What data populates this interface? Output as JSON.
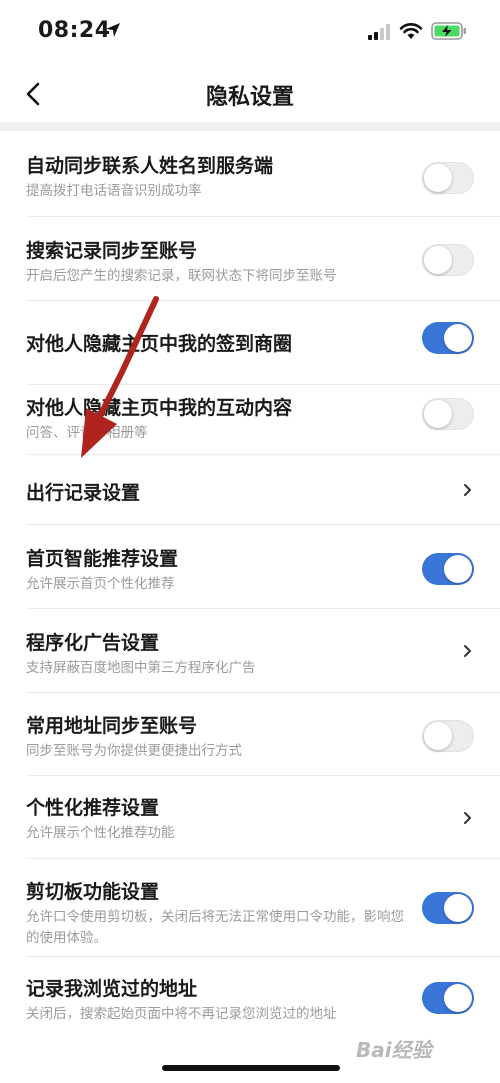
{
  "status_bar": {
    "time": "08:24",
    "icons": [
      "location-arrow-icon",
      "signal-bars-icon",
      "wifi-icon",
      "battery-charging-icon"
    ]
  },
  "nav": {
    "back_icon": "chevron-left-icon",
    "title": "隐私设置"
  },
  "settings": [
    {
      "title": "自动同步联系人姓名到服务端",
      "subtitle": "提高拨打电话语音识别成功率",
      "control": "toggle",
      "on": false
    },
    {
      "title": "搜索记录同步至账号",
      "subtitle": "开启后您产生的搜索记录，联网状态下将同步至账号",
      "control": "toggle",
      "on": false
    },
    {
      "title": "对他人隐藏主页中我的签到商圈",
      "subtitle": "",
      "control": "toggle",
      "on": true
    },
    {
      "title": "对他人隐藏主页中我的互动内容",
      "subtitle": "问答、评论、相册等",
      "control": "toggle",
      "on": false
    },
    {
      "title": "出行记录设置",
      "subtitle": "",
      "control": "chevron"
    },
    {
      "title": "首页智能推荐设置",
      "subtitle": "允许展示首页个性化推荐",
      "control": "toggle",
      "on": true
    },
    {
      "title": "程序化广告设置",
      "subtitle": "支持屏蔽百度地图中第三方程序化广告",
      "control": "chevron"
    },
    {
      "title": "常用地址同步至账号",
      "subtitle": "同步至账号为你提供更便捷出行方式",
      "control": "toggle",
      "on": false
    },
    {
      "title": "个性化推荐设置",
      "subtitle": "允许展示个性化推荐功能",
      "control": "chevron"
    },
    {
      "title": "剪切板功能设置",
      "subtitle": "允许口令使用剪切板，关闭后将无法正常使用口令功能，影响您的使用体验。",
      "control": "toggle",
      "on": true
    },
    {
      "title": "记录我浏览过的地址",
      "subtitle": "关闭后，搜索起始页面中将不再记录您浏览过的地址",
      "control": "toggle",
      "on": true
    }
  ],
  "colors": {
    "toggle_on": "#3a76d8",
    "toggle_off": "#ededed",
    "annotation_arrow": "#b0241f"
  },
  "watermark": "Bai经验"
}
